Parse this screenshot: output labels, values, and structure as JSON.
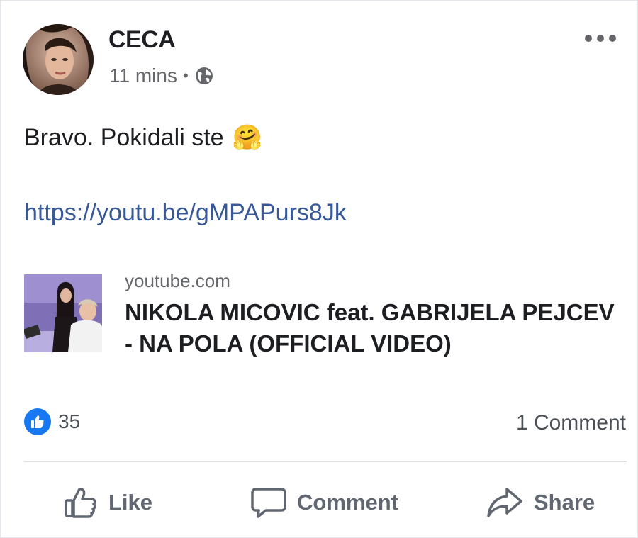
{
  "post": {
    "author": "CECA",
    "time": "11 mins",
    "separator": "•",
    "privacy_icon": "globe-icon",
    "text": "Bravo. Pokidali ste",
    "emoji": "🤗",
    "link": "https://youtu.be/gMPAPurs8Jk"
  },
  "preview": {
    "domain": "youtube.com",
    "title": "NIKOLA MICOVIC feat. GABRIJELA PEJCEV - NA POLA (OFFICIAL VIDEO)"
  },
  "stats": {
    "likes": "35",
    "comments": "1 Comment"
  },
  "actions": {
    "like": "Like",
    "comment": "Comment",
    "share": "Share"
  },
  "colors": {
    "link": "#385898",
    "like_blue": "#1877f2",
    "muted": "#65676b"
  }
}
